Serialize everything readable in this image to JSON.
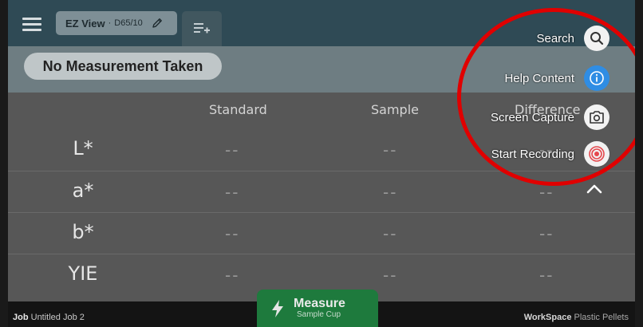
{
  "topbar": {
    "view_name": "EZ View",
    "view_separator": "·",
    "illuminant": "D65/10"
  },
  "status": {
    "text": "No Measurement Taken"
  },
  "table": {
    "columns": [
      "Standard",
      "Sample",
      "Difference"
    ],
    "rows": [
      {
        "label": "L*",
        "standard": "--",
        "sample": "--",
        "difference": "--"
      },
      {
        "label": "a*",
        "standard": "--",
        "sample": "--",
        "difference": "--"
      },
      {
        "label": "b*",
        "standard": "--",
        "sample": "--",
        "difference": "--"
      },
      {
        "label": "YIE",
        "standard": "--",
        "sample": "--",
        "difference": "--"
      }
    ]
  },
  "footer": {
    "job_label": "Job",
    "job_value": "Untitled Job 2",
    "workspace_label": "WorkSpace",
    "workspace_value": "Plastic Pellets"
  },
  "measure": {
    "title": "Measure",
    "subtitle": "Sample Cup"
  },
  "fab_menu": {
    "items": [
      {
        "label": "Search",
        "icon": "search-icon"
      },
      {
        "label": "Help Content",
        "icon": "info-icon"
      },
      {
        "label": "Screen Capture",
        "icon": "camera-icon"
      },
      {
        "label": "Start Recording",
        "icon": "record-icon"
      }
    ]
  },
  "colors": {
    "topbar": "#2f4a55",
    "measure_button": "#1e7a3d",
    "info_blue": "#2f8de4",
    "record_red": "#e5484d",
    "annotation_ring": "#e00000"
  }
}
